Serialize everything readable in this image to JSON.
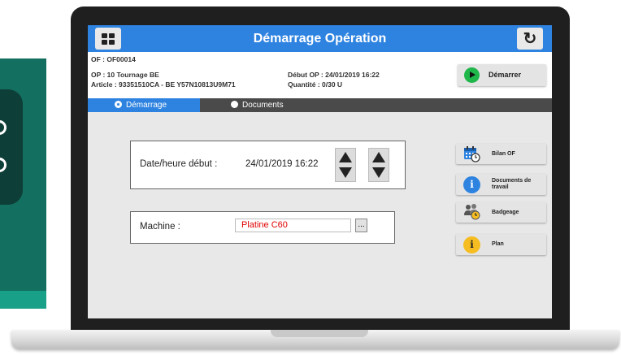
{
  "header": {
    "title": "Démarrage Opération"
  },
  "info": {
    "of": "OF : OF00014",
    "op": "OP : 10 Tournage BE",
    "article": "Article : 93351510CA - BE Y57N10813U9M71",
    "debut": "Début OP : 24/01/2019 16:22",
    "quantite": "Quantité : 0/30 U"
  },
  "actions": {
    "start_label": "Démarrer"
  },
  "tabs": [
    {
      "label": "Démarrage",
      "active": true
    },
    {
      "label": "Documents",
      "active": false
    }
  ],
  "form": {
    "datetime_label": "Date/heure début :",
    "datetime_value": "24/01/2019 16:22",
    "machine_label": "Machine :",
    "machine_value": "Platine C60",
    "ellipsis_label": "..."
  },
  "side_buttons": [
    {
      "label": "Bilan OF",
      "icon": "calendar-clock-icon"
    },
    {
      "label": "Documents de travail",
      "icon": "info-icon"
    },
    {
      "label": "Badgeage",
      "icon": "users-clock-icon"
    },
    {
      "label": "Plan",
      "icon": "info-icon"
    }
  ],
  "colors": {
    "header_blue": "#2f83e0",
    "tab_bar": "#4a4a4a",
    "start_green": "#1fb64a",
    "machine_red": "#e00000",
    "info_blue_circle": "#2f83e0",
    "info_yellow_circle": "#f5bd21"
  }
}
